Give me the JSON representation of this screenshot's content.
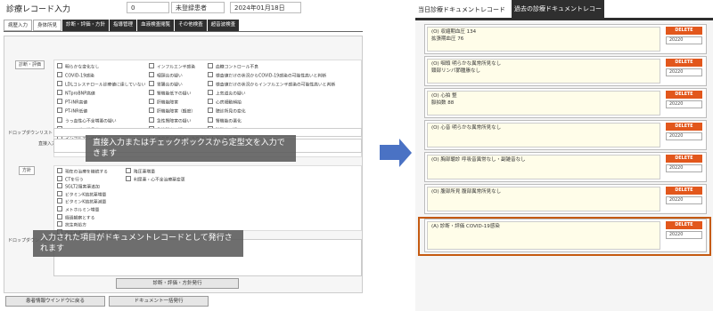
{
  "left": {
    "title": "診療レコード入力",
    "header_number": "0",
    "header_status": "未登録患者",
    "header_date": "2024年01月18日",
    "tabs": [
      "病歴入力",
      "身体所見",
      "診断・評価・方針",
      "指導管理",
      "血液検査閲覧",
      "その他検査",
      "超音波検査"
    ],
    "section_diagnosis_label": "診断・評価",
    "dropdown_label_1": "ドロップダウンリスト",
    "direct_input_label": "直接入力",
    "diagnosis_col1": [
      "明らかな変化なし",
      "COVID-19感染",
      "LDLコレステロール診療値に達していない",
      "NTproBNP高値",
      "PT-INR高値",
      "PT-INR低値",
      "うっ血性心不全増悪の疑い",
      "アレルギー性鼻炎",
      "インフルエンザA型",
      "インフルエンザB型"
    ],
    "diagnosis_col2": [
      "インフルエンザ感染",
      "咽頭炎の疑い",
      "胃腸炎の疑い",
      "腎機能低下の疑い",
      "肝機能障害",
      "肝機能障害（軽度）",
      "急性腎障害の疑い",
      "急性膵炎の疑い",
      "虚血性心疾患の可能性高い",
      "虚血性心疾患の可能性低い"
    ],
    "diagnosis_col3": [
      "血糖コントロール不良",
      "検査値だけの状況からCOVID-19感染の可能性高いと判断",
      "検査値だけの状況からインフルエンザ感染の可能性高いと判断",
      "上気道炎の疑い",
      "心房細動頻拍",
      "聴診所見の変化",
      "腎機能の悪化",
      "膀胱炎の疑い",
      "肝炎型肝機能障害",
      "頭位性眩暈の疑い（BPPV疑い）"
    ],
    "section_plan_label": "方針",
    "plan_col1": [
      "現在の治療を継続する",
      "CTを行う",
      "SGLT2阻害薬追加",
      "ビタミンK拮抗薬増量",
      "ビタミンK拮抗薬減量",
      "メトホルミン増量",
      "経過観察とする",
      "抗生剤処方",
      "抗生剤再投与（AMPC/CVA）",
      "胃薬追加"
    ],
    "plan_col2": [
      "降圧薬増量",
      "利尿薬・心不全治療薬変更"
    ],
    "dropdown_label_2": "ドロップダウンリスト",
    "issue_button": "診断・評価・方針発行",
    "bottom_button_1": "患者情報ウインドウに戻る",
    "bottom_button_2": "ドキュメント一括発行"
  },
  "callouts": {
    "top": "直接入力またはチェックボックスから定型文を入力できます",
    "bottom": "入力された項目がドキュメントレコードとして発行されます"
  },
  "right": {
    "tab_today": "当日診療ドキュメントレコード",
    "tab_past": "過去の診療ドキュメントレコード",
    "records": [
      {
        "text": "(O)  収縮期血圧  134\n拡張期血圧  76",
        "delete": "DELETE",
        "date": "20220"
      },
      {
        "text": "(O)  咽頭  明らかな異常所見なし\n頸部リンパ節腫脹なし",
        "delete": "DELETE",
        "date": "20220"
      },
      {
        "text": "(O)  心拍  整\n脈拍数  88",
        "delete": "DELETE",
        "date": "20220"
      },
      {
        "text": "(O)  心音  明らかな異常所見なし",
        "delete": "DELETE",
        "date": "20220"
      },
      {
        "text": "(O)  胸部聴診  呼吸音異常なし・副雑音なし",
        "delete": "DELETE",
        "date": "20220"
      },
      {
        "text": "(O)  腹部所見  腹部異常所見なし",
        "delete": "DELETE",
        "date": "20220"
      },
      {
        "text": "(A)  診断・評価  COVID-19感染",
        "delete": "DELETE",
        "date": "20220"
      }
    ]
  },
  "colors": {
    "delete_button": "#e2571c",
    "highlight_border": "#c55a11",
    "arrow": "#4a72c4",
    "tab_dark": "#2f2f2f"
  }
}
